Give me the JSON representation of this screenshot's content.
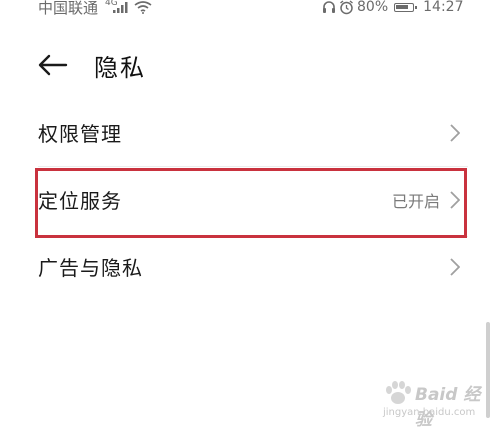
{
  "status_bar": {
    "carrier": "中国联通",
    "network": "4G",
    "battery": "80%",
    "time": "14:27"
  },
  "header": {
    "title": "隐私"
  },
  "items": [
    {
      "label": "权限管理",
      "value": ""
    },
    {
      "label": "定位服务",
      "value": "已开启"
    },
    {
      "label": "广告与隐私",
      "value": ""
    }
  ],
  "watermark": {
    "brand": "Baid 经验",
    "url": "jingyan.baidu.com"
  },
  "colors": {
    "highlight": "#c9323e",
    "chevron": "#a0a0a0"
  }
}
